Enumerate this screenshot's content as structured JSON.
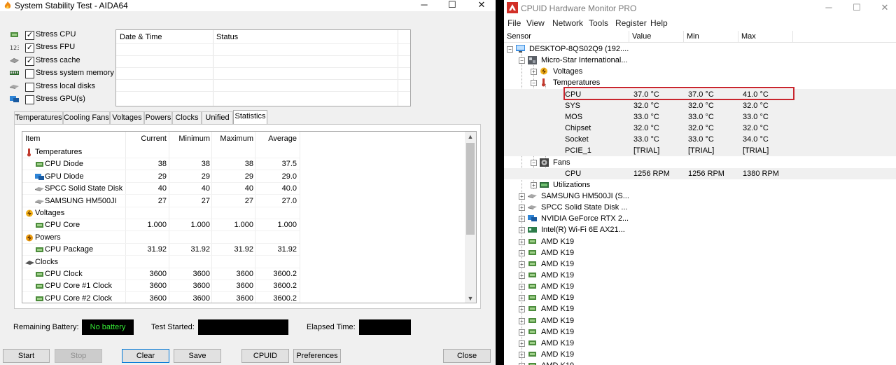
{
  "aida": {
    "title": "System Stability Test - AIDA64",
    "stress_options": [
      {
        "label": "Stress CPU",
        "checked": true,
        "icon": "cpu-chip-icon"
      },
      {
        "label": "Stress FPU",
        "checked": true,
        "icon": "fpu-123-icon"
      },
      {
        "label": "Stress cache",
        "checked": true,
        "icon": "cache-icon"
      },
      {
        "label": "Stress system memory",
        "checked": false,
        "icon": "memory-icon"
      },
      {
        "label": "Stress local disks",
        "checked": false,
        "icon": "disk-icon"
      },
      {
        "label": "Stress GPU(s)",
        "checked": false,
        "icon": "gpu-icon"
      }
    ],
    "log_headers": {
      "date_time": "Date & Time",
      "status": "Status"
    },
    "tabs": [
      "Temperatures",
      "Cooling Fans",
      "Voltages",
      "Powers",
      "Clocks",
      "Unified",
      "Statistics"
    ],
    "active_tab": "Statistics",
    "stats_headers": {
      "item": "Item",
      "current": "Current",
      "minimum": "Minimum",
      "maximum": "Maximum",
      "average": "Average"
    },
    "stats_rows": [
      {
        "name": "Temperatures",
        "group": true,
        "icon": "thermometer-icon"
      },
      {
        "name": "CPU Diode",
        "current": "38",
        "minimum": "38",
        "maximum": "38",
        "average": "37.5",
        "icon": "cpu-chip-icon"
      },
      {
        "name": "GPU Diode",
        "current": "29",
        "minimum": "29",
        "maximum": "29",
        "average": "29.0",
        "icon": "gpu-icon"
      },
      {
        "name": "SPCC Solid State Disk",
        "current": "40",
        "minimum": "40",
        "maximum": "40",
        "average": "40.0",
        "icon": "disk-icon"
      },
      {
        "name": "SAMSUNG HM500JI",
        "current": "27",
        "minimum": "27",
        "maximum": "27",
        "average": "27.0",
        "icon": "disk-icon"
      },
      {
        "name": "Voltages",
        "group": true,
        "icon": "voltage-icon"
      },
      {
        "name": "CPU Core",
        "current": "1.000",
        "minimum": "1.000",
        "maximum": "1.000",
        "average": "1.000",
        "icon": "cpu-chip-icon"
      },
      {
        "name": "Powers",
        "group": true,
        "icon": "power-icon"
      },
      {
        "name": "CPU Package",
        "current": "31.92",
        "minimum": "31.92",
        "maximum": "31.92",
        "average": "31.92",
        "icon": "cpu-chip-icon"
      },
      {
        "name": "Clocks",
        "group": true,
        "icon": "clock-chip-icon"
      },
      {
        "name": "CPU Clock",
        "current": "3600",
        "minimum": "3600",
        "maximum": "3600",
        "average": "3600.2",
        "icon": "cpu-chip-icon"
      },
      {
        "name": "CPU Core #1 Clock",
        "current": "3600",
        "minimum": "3600",
        "maximum": "3600",
        "average": "3600.2",
        "icon": "cpu-chip-icon"
      },
      {
        "name": "CPU Core #2 Clock",
        "current": "3600",
        "minimum": "3600",
        "maximum": "3600",
        "average": "3600.2",
        "icon": "cpu-chip-icon"
      }
    ],
    "remaining_battery_label": "Remaining Battery:",
    "battery_value": "No battery",
    "test_started_label": "Test Started:",
    "elapsed_time_label": "Elapsed Time:",
    "buttons": {
      "start": "Start",
      "stop": "Stop",
      "clear": "Clear",
      "save": "Save",
      "cpuid": "CPUID",
      "preferences": "Preferences",
      "close": "Close"
    }
  },
  "cpuid": {
    "title": "CPUID Hardware Monitor PRO",
    "menu": [
      "File",
      "View",
      "Network",
      "Tools",
      "Register",
      "Help"
    ],
    "columns": {
      "sensor": "Sensor",
      "value": "Value",
      "min": "Min",
      "max": "Max"
    },
    "tree": [
      {
        "label": "DESKTOP-8QS02Q9 (192....",
        "icon": "computer-icon"
      },
      {
        "label": "Micro-Star International...",
        "icon": "motherboard-icon"
      },
      {
        "label": "Voltages",
        "icon": "voltage-icon"
      },
      {
        "label": "Temperatures",
        "icon": "thermometer-icon"
      },
      {
        "label": "CPU",
        "value": "37.0 °C",
        "min": "37.0 °C",
        "max": "41.0 °C"
      },
      {
        "label": "SYS",
        "value": "32.0 °C",
        "min": "32.0 °C",
        "max": "32.0 °C"
      },
      {
        "label": "MOS",
        "value": "33.0 °C",
        "min": "33.0 °C",
        "max": "33.0 °C"
      },
      {
        "label": "Chipset",
        "value": "32.0 °C",
        "min": "32.0 °C",
        "max": "32.0 °C"
      },
      {
        "label": "Socket",
        "value": "33.0 °C",
        "min": "33.0 °C",
        "max": "34.0 °C"
      },
      {
        "label": "PCIE_1",
        "value": "[TRIAL]",
        "min": "[TRIAL]",
        "max": "[TRIAL]"
      },
      {
        "label": "Fans",
        "icon": "fan-icon"
      },
      {
        "label": "CPU",
        "value": "1256 RPM",
        "min": "1256 RPM",
        "max": "1380 RPM"
      },
      {
        "label": "Utilizations",
        "icon": "utilization-icon"
      },
      {
        "label": "SAMSUNG HM500JI (S...",
        "icon": "disk-icon"
      },
      {
        "label": "SPCC Solid State Disk ...",
        "icon": "disk-icon"
      },
      {
        "label": "NVIDIA GeForce RTX 2...",
        "icon": "gpu-icon"
      },
      {
        "label": "Intel(R) Wi-Fi 6E AX21...",
        "icon": "wifi-card-icon"
      },
      {
        "label": "AMD K19",
        "icon": "cpu-chip-icon"
      },
      {
        "label": "AMD K19",
        "icon": "cpu-chip-icon"
      },
      {
        "label": "AMD K19",
        "icon": "cpu-chip-icon"
      },
      {
        "label": "AMD K19",
        "icon": "cpu-chip-icon"
      },
      {
        "label": "AMD K19",
        "icon": "cpu-chip-icon"
      },
      {
        "label": "AMD K19",
        "icon": "cpu-chip-icon"
      },
      {
        "label": "AMD K19",
        "icon": "cpu-chip-icon"
      },
      {
        "label": "AMD K19",
        "icon": "cpu-chip-icon"
      },
      {
        "label": "AMD K19",
        "icon": "cpu-chip-icon"
      },
      {
        "label": "AMD K19",
        "icon": "cpu-chip-icon"
      },
      {
        "label": "AMD K19",
        "icon": "cpu-chip-icon"
      },
      {
        "label": "AMD K19",
        "icon": "cpu-chip-icon"
      }
    ]
  },
  "colors": {
    "battery_text": "#35e835",
    "highlight_border": "#c8252d"
  }
}
